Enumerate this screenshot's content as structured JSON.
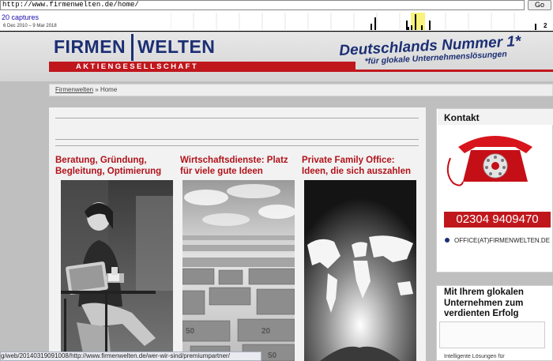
{
  "wayback": {
    "url": "http://www.firmenwelten.de/home/",
    "go_label": "Go",
    "captures_label": "20 captures",
    "date_range": "6 Dec 2010 – 9 Mar 2018",
    "next_year": "2"
  },
  "header": {
    "logo_left": "FIRMEN",
    "logo_right": "WELTEN",
    "logo_sub": "AKTIENGESELLSCHAFT",
    "slogan": "Deutschlands Nummer 1*",
    "slogan_sub": "*für glokale Unternehmenslösungen"
  },
  "breadcrumb": {
    "link": "Firmenwelten",
    "separator": "»",
    "current": "Home"
  },
  "columns": [
    {
      "title": "Beratung, Gründung, Begleitung, Optimierung",
      "image": "woman-with-tablet-photo"
    },
    {
      "title": "Wirtschaftsdienste: Platz für viele gute Ideen",
      "image": "euro-banknote-maze-photo"
    },
    {
      "title": "Private Family Office: Ideen, die sich auszahlen",
      "image": "world-map-hands-photo"
    }
  ],
  "sidebar": {
    "contact_title": "Kontakt",
    "phone": "02304 9409470",
    "email": "OFFICE(AT)FIRMENWELTEN.DE",
    "promo_title": "Mit Ihrem glokalen Unternehmen zum verdienten Erfolg",
    "promo_text": "Intelligente Lösungen für"
  },
  "status_bar": "g/web/20140319091008/http://www.firmenwelten.de/wer-wir-sind/premiumpartner/",
  "colors": {
    "brand_blue": "#1c2f74",
    "brand_red": "#c0171d"
  }
}
